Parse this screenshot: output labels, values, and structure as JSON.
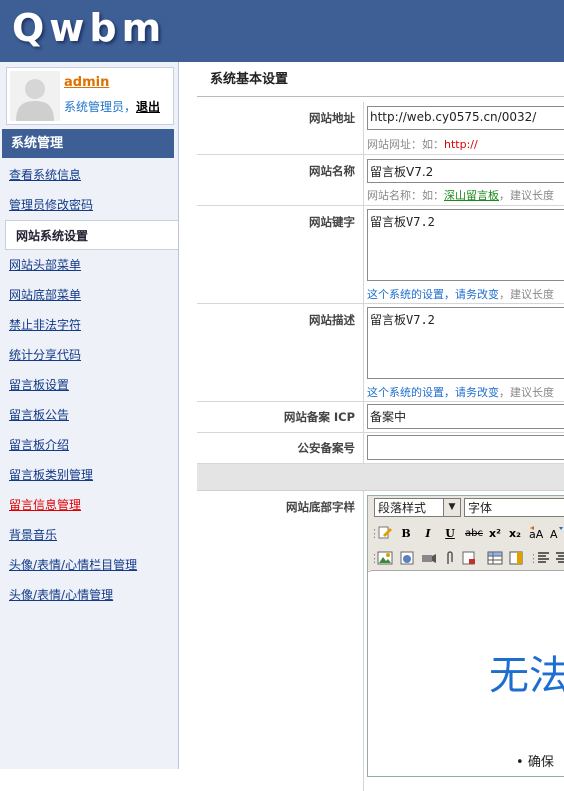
{
  "header": {
    "logo": "Qwbm"
  },
  "user": {
    "name": "admin",
    "role": "系统管理员",
    "separator": "，",
    "logout": "退出"
  },
  "sidebar": {
    "title": "系统管理",
    "items": [
      {
        "label": "查看系统信息"
      },
      {
        "label": "管理员修改密码"
      },
      {
        "label": "网站系统设置",
        "active": true
      },
      {
        "label": "网站头部菜单"
      },
      {
        "label": "网站底部菜单"
      },
      {
        "label": "禁止非法字符"
      },
      {
        "label": "统计分享代码"
      },
      {
        "label": "留言板设置"
      },
      {
        "label": "留言板公告"
      },
      {
        "label": "留言板介绍"
      },
      {
        "label": "留言板类别管理"
      },
      {
        "label": "留言信息管理",
        "highlight": "red"
      },
      {
        "label": "背景音乐"
      },
      {
        "label": "头像/表情/心情栏目管理"
      },
      {
        "label": "头像/表情/心情管理"
      }
    ]
  },
  "main": {
    "title": "系统基本设置",
    "fields": {
      "site_url": {
        "label": "网站地址",
        "value": "http://web.cy0575.cn/0032/",
        "hint_prefix": "网站网址：如：",
        "hint_example": "http://"
      },
      "site_name": {
        "label": "网站名称",
        "value": "留言板V7.2",
        "hint_prefix": "网站名称：如：",
        "hint_example": "深山留言板",
        "hint_suffix": "，建议长度"
      },
      "keywords": {
        "label": "网站键字",
        "value": "留言板V7.2",
        "hint_blue": "这个系统的设置，请务改变",
        "hint_suffix": "，建议长度"
      },
      "description": {
        "label": "网站描述",
        "value": "留言板V7.2",
        "hint_blue": "这个系统的设置，请务改变",
        "hint_suffix": "，建议长度"
      },
      "icp": {
        "label": "网站备案 ICP",
        "value": "备案中"
      },
      "police": {
        "label": "公安备案号",
        "value": ""
      },
      "footer": {
        "label": "网站底部字样"
      }
    },
    "editor": {
      "paragraph_style": "段落样式",
      "font": "字体",
      "toolbar2": [
        "B",
        "I",
        "U",
        "abc",
        "x²",
        "x₂"
      ],
      "big_text": "无法",
      "bullet_text": "确保"
    }
  }
}
